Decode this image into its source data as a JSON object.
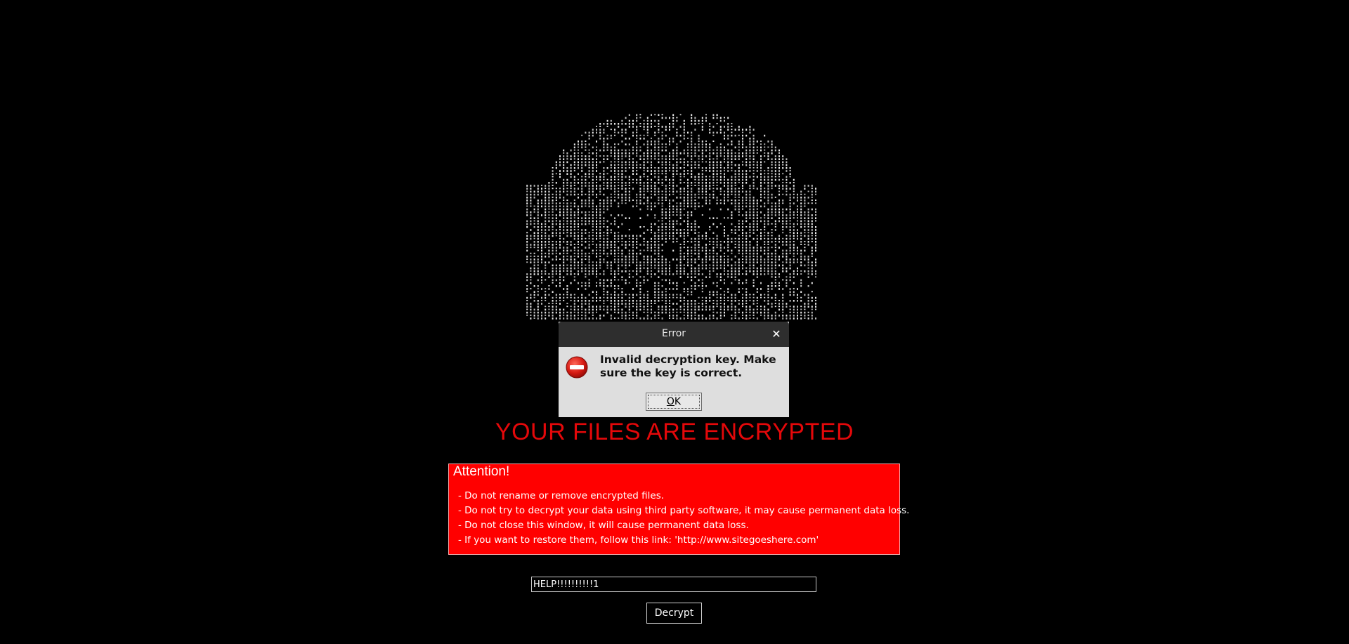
{
  "headline": "YOUR FILES ARE ENCRYPTED",
  "attention": {
    "title": "Attention!",
    "items": [
      "- Do not rename or remove encrypted files.",
      "- Do not try to decrypt your data using third party software, it may cause permanent data loss.",
      "- Do not close this window, it will cause permanent data loss.",
      "- If you want to restore them, follow this link: 'http://www.sitegoeshere.com'"
    ]
  },
  "key_input": {
    "value": "HELP!!!!!!!!!!1"
  },
  "decrypt_button": "Decrypt",
  "dialog": {
    "title": "Error",
    "close_icon": "close-icon",
    "icon": "error-stop-icon",
    "message": "Invalid decryption key. Make sure the key is correct.",
    "ok_first": "O",
    "ok_rest": "K"
  },
  "colors": {
    "background": "#000000",
    "headline": "#e4080a",
    "attention_panel": "#ff0000",
    "dialog_titlebar": "#2e2e2e",
    "dialog_body": "#dedede"
  }
}
